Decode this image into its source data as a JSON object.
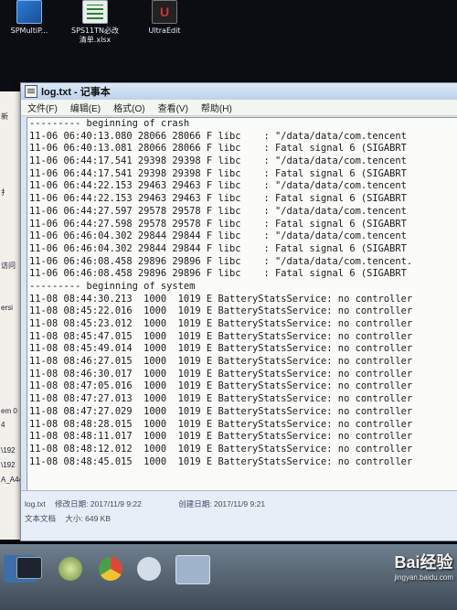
{
  "desktop_icons": [
    {
      "label": "SPMultiP...",
      "icon": "app-icon"
    },
    {
      "label": "SPS11TN必改",
      "label2": "清单.xlsx",
      "icon": "excel-file-icon"
    },
    {
      "label": "UltraEdit",
      "icon": "ultraedit-icon"
    }
  ],
  "left_window_fragments": [
    "新",
    "扌",
    "访问",
    "ersi",
    "em 0",
    "4",
    "\\192",
    "\\192",
    "A_A44"
  ],
  "window": {
    "title": "log.txt - 记事本",
    "menu": [
      "文件(F)",
      "编辑(E)",
      "格式(O)",
      "查看(V)",
      "帮助(H)"
    ]
  },
  "log_lines": [
    "--------- beginning of crash",
    "11-06 06:40:13.080 28066 28066 F libc    : \"/data/data/com.tencent",
    "11-06 06:40:13.081 28066 28066 F libc    : Fatal signal 6 (SIGABRT",
    "11-06 06:44:17.541 29398 29398 F libc    : \"/data/data/com.tencent",
    "11-06 06:44:17.541 29398 29398 F libc    : Fatal signal 6 (SIGABRT",
    "11-06 06:44:22.153 29463 29463 F libc    : \"/data/data/com.tencent",
    "11-06 06:44:22.153 29463 29463 F libc    : Fatal signal 6 (SIGABRT",
    "11-06 06:44:27.597 29578 29578 F libc    : \"/data/data/com.tencent",
    "11-06 06:44:27.598 29578 29578 F libc    : Fatal signal 6 (SIGABRT",
    "11-06 06:46:04.302 29844 29844 F libc    : \"/data/data/com.tencent",
    "11-06 06:46:04.302 29844 29844 F libc    : Fatal signal 6 (SIGABRT",
    "11-06 06:46:08.458 29896 29896 F libc    : \"/data/data/com.tencent.",
    "11-06 06:46:08.458 29896 29896 F libc    : Fatal signal 6 (SIGABRT",
    "--------- beginning of system",
    "11-08 08:44:30.213  1000  1019 E BatteryStatsService: no controller",
    "11-08 08:45:22.016  1000  1019 E BatteryStatsService: no controller",
    "11-08 08:45:23.012  1000  1019 E BatteryStatsService: no controller",
    "11-08 08:45:47.015  1000  1019 E BatteryStatsService: no controller",
    "11-08 08:45:49.014  1000  1019 E BatteryStatsService: no controller",
    "11-08 08:46:27.015  1000  1019 E BatteryStatsService: no controller",
    "11-08 08:46:30.017  1000  1019 E BatteryStatsService: no controller",
    "11-08 08:47:05.016  1000  1019 E BatteryStatsService: no controller",
    "11-08 08:47:27.013  1000  1019 E BatteryStatsService: no controller",
    "11-08 08:47:27.029  1000  1019 E BatteryStatsService: no controller",
    "11-08 08:48:28.015  1000  1019 E BatteryStatsService: no controller",
    "11-08 08:48:11.017  1000  1019 E BatteryStatsService: no controller",
    "11-08 08:48:12.012  1000  1019 E BatteryStatsService: no controller",
    "11-08 08:48:45.015  1000  1019 E BatteryStatsService: no controller"
  ],
  "status": {
    "filename": "log.txt",
    "modified": "修改日期: 2017/11/9 9:22",
    "created": "创建日期: 2017/11/9 9:21",
    "type": "文本文档",
    "size": "大小: 649 KB"
  },
  "taskbar": {
    "apps": [
      "explorer-icon",
      "terminal-icon",
      "ie-icon",
      "chrome-icon",
      "baidu-icon",
      "notepad-icon"
    ],
    "watermark": "Bai经验",
    "watermark_sub": "jingyan.baidu.com"
  },
  "colors": {
    "desktop": "#0b0d12",
    "titlebar": "#bcd2ea",
    "editor_bg": "#fbfbfa",
    "taskbar": "#4f5d6c"
  }
}
